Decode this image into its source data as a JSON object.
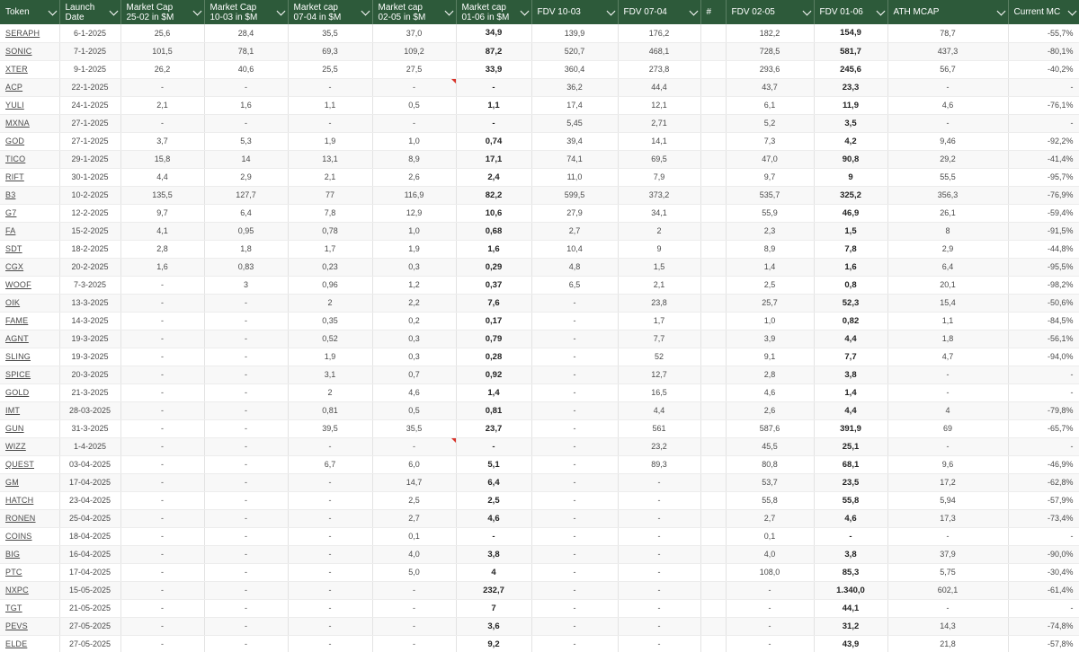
{
  "headers": {
    "token": "Token",
    "launch": "Launch\nDate",
    "mcap_2502": "Market Cap\n25-02 in $M",
    "mcap_1003": "Market Cap\n10-03 in $M",
    "mcap_0704": "Market cap\n07-04 in $M",
    "mcap_0205": "Market cap\n02-05 in $M",
    "mcap_0106": "Market cap\n01-06 in $M",
    "fdv_1003": "FDV 10-03",
    "fdv_0704": "FDV 07-04",
    "hash": "#",
    "fdv_0205": "FDV 02-05",
    "fdv_0106": "FDV 01-06",
    "ath_mcap": "ATH MCAP",
    "current": "Current MC"
  },
  "colors": {
    "header_bg": "#2d5a3a",
    "header_text": "#ffffff",
    "flag": "#d9342b"
  },
  "rows": [
    {
      "t": "SERAPH",
      "d": "6-1-2025",
      "m1": "25,6",
      "m2": "28,4",
      "m3": "35,5",
      "m4": "37,0",
      "m5": "34,9",
      "f1": "139,9",
      "f2": "176,2",
      "f3": "182,2",
      "f4": "154,9",
      "ath": "78,7",
      "cur": "-55,7%"
    },
    {
      "t": "SONIC",
      "d": "7-1-2025",
      "m1": "101,5",
      "m2": "78,1",
      "m3": "69,3",
      "m4": "109,2",
      "m5": "87,2",
      "f1": "520,7",
      "f2": "468,1",
      "f3": "728,5",
      "f4": "581,7",
      "ath": "437,3",
      "cur": "-80,1%"
    },
    {
      "t": "XTER",
      "d": "9-1-2025",
      "m1": "26,2",
      "m2": "40,6",
      "m3": "25,5",
      "m4": "27,5",
      "m5": "33,9",
      "f1": "360,4",
      "f2": "273,8",
      "f3": "293,6",
      "f4": "245,6",
      "ath": "56,7",
      "cur": "-40,2%"
    },
    {
      "t": "ACP",
      "d": "22-1-2025",
      "m1": "-",
      "m2": "-",
      "m3": "-",
      "m4": "-",
      "m5": "-",
      "f1": "36,2",
      "f2": "44,4",
      "f3": "43,7",
      "f4": "23,3",
      "ath": "-",
      "cur": "-"
    },
    {
      "t": "YULI",
      "d": "24-1-2025",
      "m1": "2,1",
      "m2": "1,6",
      "m3": "1,1",
      "m4": "0,5",
      "m5": "1,1",
      "f1": "17,4",
      "f2": "12,1",
      "f3": "6,1",
      "f4": "11,9",
      "ath": "4,6",
      "cur": "-76,1%"
    },
    {
      "t": "MXNA",
      "d": "27-1-2025",
      "m1": "-",
      "m2": "-",
      "m3": "-",
      "m4": "-",
      "m5": "-",
      "f1": "5,45",
      "f2": "2,71",
      "f3": "5,2",
      "f4": "3,5",
      "ath": "-",
      "cur": "-"
    },
    {
      "t": "GOD",
      "d": "27-1-2025",
      "m1": "3,7",
      "m2": "5,3",
      "m3": "1,9",
      "m4": "1,0",
      "m5": "0,74",
      "f1": "39,4",
      "f2": "14,1",
      "f3": "7,3",
      "f4": "4,2",
      "ath": "9,46",
      "cur": "-92,2%"
    },
    {
      "t": "TICO",
      "d": "29-1-2025",
      "m1": "15,8",
      "m2": "14",
      "m3": "13,1",
      "m4": "8,9",
      "m5": "17,1",
      "f1": "74,1",
      "f2": "69,5",
      "f3": "47,0",
      "f4": "90,8",
      "ath": "29,2",
      "cur": "-41,4%"
    },
    {
      "t": "RIFT",
      "d": "30-1-2025",
      "m1": "4,4",
      "m2": "2,9",
      "m3": "2,1",
      "m4": "2,6",
      "m5": "2,4",
      "f1": "11,0",
      "f2": "7,9",
      "f3": "9,7",
      "f4": "9",
      "ath": "55,5",
      "cur": "-95,7%"
    },
    {
      "t": "B3",
      "d": "10-2-2025",
      "m1": "135,5",
      "m2": "127,7",
      "m3": "77",
      "m4": "116,9",
      "m5": "82,2",
      "f1": "599,5",
      "f2": "373,2",
      "f3": "535,7",
      "f4": "325,2",
      "ath": "356,3",
      "cur": "-76,9%"
    },
    {
      "t": "G7",
      "d": "12-2-2025",
      "m1": "9,7",
      "m2": "6,4",
      "m3": "7,8",
      "m4": "12,9",
      "m5": "10,6",
      "f1": "27,9",
      "f2": "34,1",
      "f3": "55,9",
      "f4": "46,9",
      "ath": "26,1",
      "cur": "-59,4%"
    },
    {
      "t": "FA",
      "d": "15-2-2025",
      "m1": "4,1",
      "m2": "0,95",
      "m3": "0,78",
      "m4": "1,0",
      "m5": "0,68",
      "f1": "2,7",
      "f2": "2",
      "f3": "2,3",
      "f4": "1,5",
      "ath": "8",
      "cur": "-91,5%"
    },
    {
      "t": "SDT",
      "d": "18-2-2025",
      "m1": "2,8",
      "m2": "1,8",
      "m3": "1,7",
      "m4": "1,9",
      "m5": "1,6",
      "f1": "10,4",
      "f2": "9",
      "f3": "8,9",
      "f4": "7,8",
      "ath": "2,9",
      "cur": "-44,8%"
    },
    {
      "t": "CGX",
      "d": "20-2-2025",
      "m1": "1,6",
      "m2": "0,83",
      "m3": "0,23",
      "m4": "0,3",
      "m5": "0,29",
      "f1": "4,8",
      "f2": "1,5",
      "f3": "1,4",
      "f4": "1,6",
      "ath": "6,4",
      "cur": "-95,5%"
    },
    {
      "t": "WOOF",
      "d": "7-3-2025",
      "m1": "-",
      "m2": "3",
      "m3": "0,96",
      "m4": "1,2",
      "m5": "0,37",
      "f1": "6,5",
      "f2": "2,1",
      "f3": "2,5",
      "f4": "0,8",
      "ath": "20,1",
      "cur": "-98,2%"
    },
    {
      "t": "OIK",
      "d": "13-3-2025",
      "m1": "-",
      "m2": "-",
      "m3": "2",
      "m4": "2,2",
      "m5": "7,6",
      "f1": "-",
      "f2": "23,8",
      "f3": "25,7",
      "f4": "52,3",
      "ath": "15,4",
      "cur": "-50,6%"
    },
    {
      "t": "FAME",
      "d": "14-3-2025",
      "m1": "-",
      "m2": "-",
      "m3": "0,35",
      "m4": "0,2",
      "m5": "0,17",
      "f1": "-",
      "f2": "1,7",
      "f3": "1,0",
      "f4": "0,82",
      "ath": "1,1",
      "cur": "-84,5%"
    },
    {
      "t": "AGNT",
      "d": "19-3-2025",
      "m1": "-",
      "m2": "-",
      "m3": "0,52",
      "m4": "0,3",
      "m5": "0,79",
      "f1": "-",
      "f2": "7,7",
      "f3": "3,9",
      "f4": "4,4",
      "ath": "1,8",
      "cur": "-56,1%"
    },
    {
      "t": "SLING",
      "d": "19-3-2025",
      "m1": "-",
      "m2": "-",
      "m3": "1,9",
      "m4": "0,3",
      "m5": "0,28",
      "f1": "-",
      "f2": "52",
      "f3": "9,1",
      "f4": "7,7",
      "ath": "4,7",
      "cur": "-94,0%"
    },
    {
      "t": "SPICE",
      "d": "20-3-2025",
      "m1": "-",
      "m2": "-",
      "m3": "3,1",
      "m4": "0,7",
      "m5": "0,92",
      "f1": "-",
      "f2": "12,7",
      "f3": "2,8",
      "f4": "3,8",
      "ath": "-",
      "cur": "-"
    },
    {
      "t": "GOLD",
      "d": "21-3-2025",
      "m1": "-",
      "m2": "-",
      "m3": "2",
      "m4": "4,6",
      "m5": "1,4",
      "f1": "-",
      "f2": "16,5",
      "f3": "4,6",
      "f4": "1,4",
      "ath": "-",
      "cur": "-"
    },
    {
      "t": "IMT",
      "d": "28-03-2025",
      "m1": "-",
      "m2": "-",
      "m3": "0,81",
      "m4": "0,5",
      "m5": "0,81",
      "f1": "-",
      "f2": "4,4",
      "f3": "2,6",
      "f4": "4,4",
      "ath": "4",
      "cur": "-79,8%"
    },
    {
      "t": "GUN",
      "d": "31-3-2025",
      "m1": "-",
      "m2": "-",
      "m3": "39,5",
      "m4": "35,5",
      "m5": "23,7",
      "f1": "-",
      "f2": "561",
      "f3": "587,6",
      "f4": "391,9",
      "ath": "69",
      "cur": "-65,7%"
    },
    {
      "t": "WIZZ",
      "d": "1-4-2025",
      "m1": "-",
      "m2": "-",
      "m3": "-",
      "m4": "-",
      "m5": "-",
      "f1": "-",
      "f2": "23,2",
      "f3": "45,5",
      "f4": "25,1",
      "ath": "-",
      "cur": "-"
    },
    {
      "t": "QUEST",
      "d": "03-04-2025",
      "m1": "-",
      "m2": "-",
      "m3": "6,7",
      "m4": "6,0",
      "m5": "5,1",
      "f1": "-",
      "f2": "89,3",
      "f3": "80,8",
      "f4": "68,1",
      "ath": "9,6",
      "cur": "-46,9%"
    },
    {
      "t": "GM",
      "d": "17-04-2025",
      "m1": "-",
      "m2": "-",
      "m3": "-",
      "m4": "14,7",
      "m5": "6,4",
      "f1": "-",
      "f2": "-",
      "f3": "53,7",
      "f4": "23,5",
      "ath": "17,2",
      "cur": "-62,8%"
    },
    {
      "t": "HATCH",
      "d": "23-04-2025",
      "m1": "-",
      "m2": "-",
      "m3": "-",
      "m4": "2,5",
      "m5": "2,5",
      "f1": "-",
      "f2": "-",
      "f3": "55,8",
      "f4": "55,8",
      "ath": "5,94",
      "cur": "-57,9%"
    },
    {
      "t": "RONEN",
      "d": "25-04-2025",
      "m1": "-",
      "m2": "-",
      "m3": "-",
      "m4": "2,7",
      "m5": "4,6",
      "f1": "-",
      "f2": "-",
      "f3": "2,7",
      "f4": "4,6",
      "ath": "17,3",
      "cur": "-73,4%"
    },
    {
      "t": "COINS",
      "d": "18-04-2025",
      "m1": "-",
      "m2": "-",
      "m3": "-",
      "m4": "0,1",
      "m5": "-",
      "f1": "-",
      "f2": "-",
      "f3": "0,1",
      "f4": "-",
      "ath": "-",
      "cur": "-"
    },
    {
      "t": "BIG",
      "d": "16-04-2025",
      "m1": "-",
      "m2": "-",
      "m3": "-",
      "m4": "4,0",
      "m5": "3,8",
      "f1": "-",
      "f2": "-",
      "f3": "4,0",
      "f4": "3,8",
      "ath": "37,9",
      "cur": "-90,0%"
    },
    {
      "t": "PTC",
      "d": "17-04-2025",
      "m1": "-",
      "m2": "-",
      "m3": "-",
      "m4": "5,0",
      "m5": "4",
      "f1": "-",
      "f2": "-",
      "f3": "108,0",
      "f4": "85,3",
      "ath": "5,75",
      "cur": "-30,4%"
    },
    {
      "t": "NXPC",
      "d": "15-05-2025",
      "m1": "-",
      "m2": "-",
      "m3": "-",
      "m4": "-",
      "m5": "232,7",
      "f1": "-",
      "f2": "-",
      "f3": "-",
      "f4": "1.340,0",
      "ath": "602,1",
      "cur": "-61,4%"
    },
    {
      "t": "TGT",
      "d": "21-05-2025",
      "m1": "-",
      "m2": "-",
      "m3": "-",
      "m4": "-",
      "m5": "7",
      "f1": "-",
      "f2": "-",
      "f3": "-",
      "f4": "44,1",
      "ath": "-",
      "cur": "-"
    },
    {
      "t": "PEVS",
      "d": "27-05-2025",
      "m1": "-",
      "m2": "-",
      "m3": "-",
      "m4": "-",
      "m5": "3,6",
      "f1": "-",
      "f2": "-",
      "f3": "-",
      "f4": "31,2",
      "ath": "14,3",
      "cur": "-74,8%"
    },
    {
      "t": "ELDE",
      "d": "27-05-2025",
      "m1": "-",
      "m2": "-",
      "m3": "-",
      "m4": "-",
      "m5": "9,2",
      "f1": "-",
      "f2": "-",
      "f3": "-",
      "f4": "43,9",
      "ath": "21,8",
      "cur": "-57,8%"
    }
  ]
}
